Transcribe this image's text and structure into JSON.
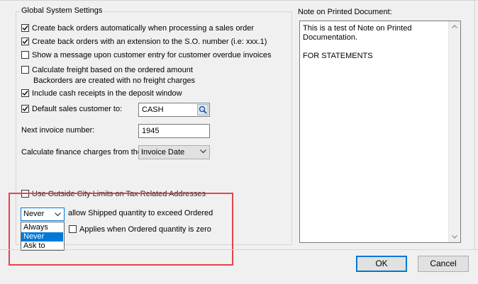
{
  "settings": {
    "group_title": "Global System Settings",
    "opt_back_orders_auto": {
      "label": "Create back orders automatically when processing a sales order",
      "checked": true
    },
    "opt_back_orders_ext": {
      "label": "Create back orders with an extension to the S.O. number (i.e: xxx.1)",
      "checked": true
    },
    "opt_overdue_message": {
      "label": "Show a message upon customer entry for customer overdue invoices",
      "checked": false
    },
    "opt_calc_freight": {
      "label": "Calculate freight based on the ordered amount",
      "checked": false
    },
    "freight_note": "Backorders are created with no freight charges",
    "opt_cash_receipts": {
      "label": "Include cash receipts in the deposit window",
      "checked": true
    },
    "opt_default_customer": {
      "label": "Default sales customer to:",
      "checked": true
    },
    "default_customer_value": "CASH",
    "next_invoice_label": "Next invoice number:",
    "next_invoice_value": "1945",
    "finance_label": "Calculate finance charges from the",
    "finance_value": "Invoice Date",
    "opt_city_limits": {
      "label": "Use Outside City Limits on Tax Related Addresses",
      "checked": false
    },
    "shipped_select_value": "Never",
    "shipped_label": "allow Shipped quantity to exceed Ordered",
    "shipped_options": [
      "Always",
      "Never",
      "Ask to"
    ],
    "shipped_selected_index": 1,
    "opt_applies_zero": {
      "label": "Applies when Ordered quantity is zero",
      "checked": false
    }
  },
  "note": {
    "title": "Note on Printed Document:",
    "text_line1": "This is a test of Note on Printed",
    "text_line2": "Documentation.",
    "text_line3": "FOR STATEMENTS"
  },
  "buttons": {
    "ok": "OK",
    "cancel": "Cancel"
  },
  "colors": {
    "highlight_box": "#e5434b",
    "selection": "#0078d7"
  },
  "icons": {
    "lookup": "magnifier-icon",
    "check": "check-icon",
    "dropdown": "chevron-down-icon"
  }
}
